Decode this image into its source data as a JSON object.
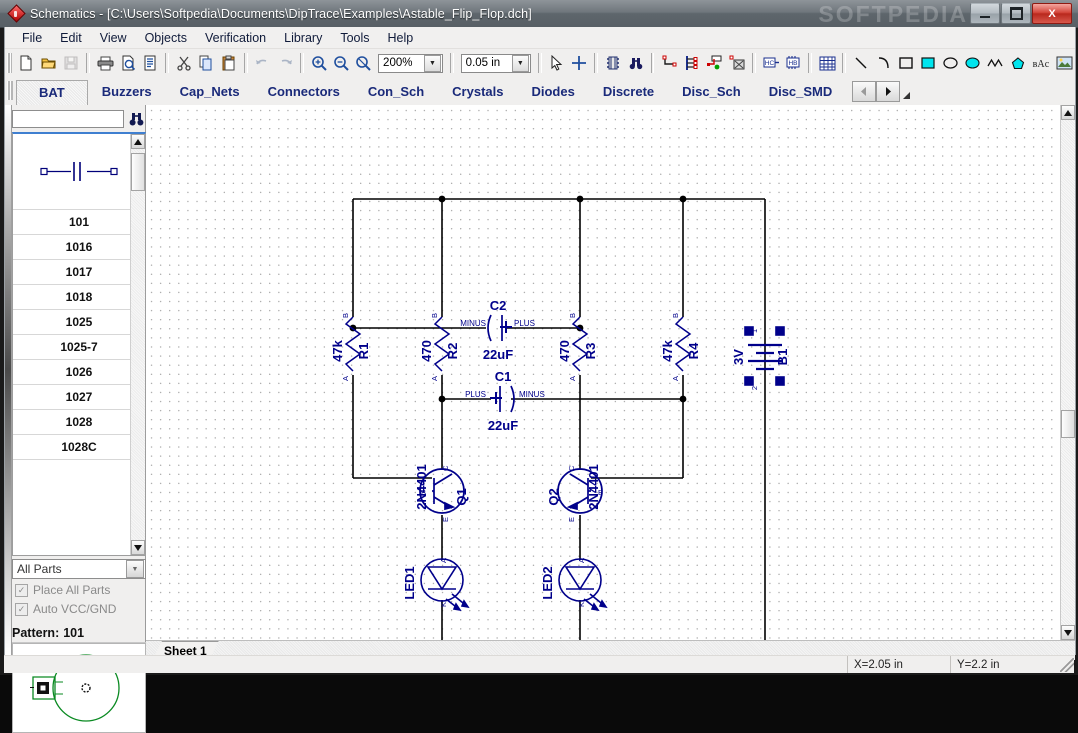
{
  "window": {
    "title": "Schematics - [C:\\Users\\Softpedia\\Documents\\DipTrace\\Examples\\Astable_Flip_Flop.dch]",
    "watermark": "SOFTPEDIA",
    "minimize_label": "Minimize",
    "maximize_label": "Maximize",
    "close_label": "X"
  },
  "menu": {
    "items": [
      {
        "label": "File"
      },
      {
        "label": "Edit"
      },
      {
        "label": "View"
      },
      {
        "label": "Objects"
      },
      {
        "label": "Verification"
      },
      {
        "label": "Library"
      },
      {
        "label": "Tools"
      },
      {
        "label": "Help"
      }
    ]
  },
  "toolbar": {
    "buttons": [
      {
        "name": "new-file-icon",
        "title": "New"
      },
      {
        "name": "open-folder-icon",
        "title": "Open"
      },
      {
        "name": "save-disk-icon",
        "title": "Save"
      },
      {
        "name": "print-icon",
        "title": "Print"
      },
      {
        "name": "print-preview-icon",
        "title": "Print Preview"
      },
      {
        "name": "report-icon",
        "title": "Report"
      },
      {
        "name": "cut-scissors-icon",
        "title": "Cut"
      },
      {
        "name": "copy-icon",
        "title": "Copy"
      },
      {
        "name": "paste-icon",
        "title": "Paste"
      },
      {
        "name": "undo-arrow-icon",
        "title": "Undo"
      },
      {
        "name": "redo-arrow-icon",
        "title": "Redo"
      },
      {
        "name": "zoom-in-icon",
        "title": "Zoom In"
      },
      {
        "name": "zoom-out-icon",
        "title": "Zoom Out"
      },
      {
        "name": "zoom-window-icon",
        "title": "Zoom Window"
      }
    ],
    "zoom_value": "200%",
    "grid_value": "0.05 in",
    "right_buttons": [
      {
        "name": "select-arrow-icon",
        "title": "Select"
      },
      {
        "name": "crosshair-icon",
        "title": "Place"
      },
      {
        "name": "component-icon",
        "title": "Place Component"
      },
      {
        "name": "binoculars-icon",
        "title": "Find Component"
      },
      {
        "name": "wire-icon",
        "title": "Place Wire"
      },
      {
        "name": "bus-icon",
        "title": "Place Bus"
      },
      {
        "name": "net-port-icon",
        "title": "Place Net Port"
      },
      {
        "name": "net-flag-icon",
        "title": "Net Flag"
      },
      {
        "name": "no-connect-icon",
        "title": "No Connect"
      },
      {
        "name": "chip-icon",
        "title": "Chip"
      },
      {
        "name": "table-icon",
        "title": "Table"
      },
      {
        "name": "line-icon",
        "title": "Line"
      },
      {
        "name": "arc-icon",
        "title": "Arc"
      },
      {
        "name": "rect-outline-icon",
        "title": "Rectangle"
      },
      {
        "name": "rect-filled-icon",
        "title": "Filled Rectangle"
      },
      {
        "name": "ellipse-outline-icon",
        "title": "Ellipse"
      },
      {
        "name": "ellipse-filled-icon",
        "title": "Filled Ellipse"
      },
      {
        "name": "polyline-icon",
        "title": "Polyline"
      },
      {
        "name": "polygon-icon",
        "title": "Polygon"
      },
      {
        "name": "text-abc-icon",
        "title": "Text"
      },
      {
        "name": "image-icon",
        "title": "Image"
      }
    ]
  },
  "library_tabs": {
    "active": "BAT",
    "items": [
      {
        "label": "BAT"
      },
      {
        "label": "Buzzers"
      },
      {
        "label": "Cap_Nets"
      },
      {
        "label": "Connectors"
      },
      {
        "label": "Con_Sch"
      },
      {
        "label": "Crystals"
      },
      {
        "label": "Diodes"
      },
      {
        "label": "Discrete"
      },
      {
        "label": "Disc_Sch"
      },
      {
        "label": "Disc_SMD"
      }
    ],
    "prev_label": "◀",
    "next_label": "▶",
    "more_label": "◢"
  },
  "left_panel": {
    "search_value": "",
    "search_placeholder": "",
    "find_icon": "binoculars-icon",
    "preview_icon": "capacitor-symbol",
    "items": [
      {
        "label": "101"
      },
      {
        "label": "1016"
      },
      {
        "label": "1017"
      },
      {
        "label": "1018"
      },
      {
        "label": "1025"
      },
      {
        "label": "1025-7"
      },
      {
        "label": "1026"
      },
      {
        "label": "1027"
      },
      {
        "label": "1028"
      },
      {
        "label": "1028C"
      }
    ],
    "parts_filter": "All Parts",
    "place_all_parts": {
      "label": "Place All Parts",
      "checked": true,
      "mark": "✓"
    },
    "auto_vcc_gnd": {
      "label": "Auto VCC/GND",
      "checked": true,
      "mark": "✓"
    },
    "pattern_label": "Pattern:",
    "pattern_value": "101"
  },
  "sheet": {
    "tab_label": "Sheet 1"
  },
  "status": {
    "blank": "",
    "x": "X=2.05 in",
    "y": "Y=2.2 in"
  },
  "schematic": {
    "wire_color": "#000000",
    "symbol_color": "#00008b",
    "title": "Astable Flip Flop",
    "components": [
      {
        "ref": "R1",
        "value": "47k",
        "type": "resistor",
        "pin_a": "A",
        "pin_b": "B"
      },
      {
        "ref": "R2",
        "value": "470",
        "type": "resistor",
        "pin_a": "A",
        "pin_b": "B"
      },
      {
        "ref": "R3",
        "value": "470",
        "type": "resistor",
        "pin_a": "A",
        "pin_b": "B"
      },
      {
        "ref": "R4",
        "value": "47k",
        "type": "resistor",
        "pin_a": "A",
        "pin_b": "B"
      },
      {
        "ref": "C1",
        "value": "22uF",
        "type": "capacitor",
        "pin_left": "PLUS",
        "pin_right": "MINUS"
      },
      {
        "ref": "C2",
        "value": "22uF",
        "type": "capacitor",
        "pin_left": "MINUS",
        "pin_right": "PLUS"
      },
      {
        "ref": "Q1",
        "value": "2N4401",
        "type": "transistor-npn",
        "pin_b": "B",
        "pin_c": "C",
        "pin_e": "E"
      },
      {
        "ref": "Q2",
        "value": "2N4401",
        "type": "transistor-npn",
        "pin_b": "B",
        "pin_c": "C",
        "pin_e": "E"
      },
      {
        "ref": "LED1",
        "value": "",
        "type": "led",
        "pin_a": "A",
        "pin_k": "K"
      },
      {
        "ref": "LED2",
        "value": "",
        "type": "led",
        "pin_a": "A",
        "pin_k": "K"
      },
      {
        "ref": "B1",
        "value": "3V",
        "type": "battery",
        "pin_1": "1",
        "pin_2": "2"
      }
    ]
  }
}
